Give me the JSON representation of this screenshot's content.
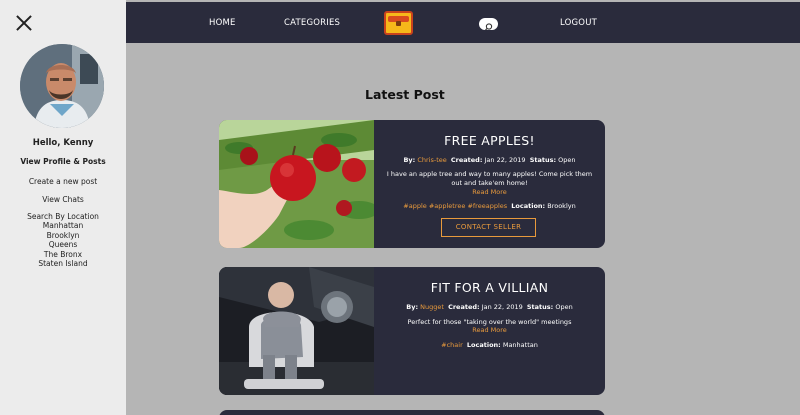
{
  "sidebar": {
    "greeting": "Hello, Kenny",
    "links": {
      "profile": "View Profile & Posts",
      "create": "Create a new post",
      "chats": "View Chats"
    },
    "search_title": "Search By Location",
    "locations": [
      "Manhattan",
      "Brooklyn",
      "Queens",
      "The Bronx",
      "Staten Island"
    ]
  },
  "nav": {
    "home": "HOME",
    "categories": "CATEGORIES",
    "logout": "LOGOUT"
  },
  "main": {
    "title": "Latest Post",
    "posts": [
      {
        "title": "FREE APPLES!",
        "by_label": "By:",
        "author": "Chris-tee",
        "created_label": "Created:",
        "created": "Jan 22, 2019",
        "status_label": "Status:",
        "status": "Open",
        "description": "I have an apple tree and way to many apples! Come pick them out and take'em home!",
        "read_more": "Read More",
        "tags": "#apple #appletree #freeapples",
        "location_label": "Location:",
        "location": "Brooklyn",
        "button": "CONTACT SELLER"
      },
      {
        "title": "FIT FOR A VILLIAN",
        "by_label": "By:",
        "author": "Nugget",
        "created_label": "Created:",
        "created": "Jan 22, 2019",
        "status_label": "Status:",
        "status": "Open",
        "description": "Perfect for those \"taking over the world\" meetings",
        "read_more": "Read More",
        "tags": "#chair",
        "location_label": "Location:",
        "location": "Manhattan"
      }
    ]
  },
  "colors": {
    "accent": "#e89a3c",
    "navbar": "#2a2b3c",
    "background": "#b5b5b5",
    "sidebar": "#ececec"
  },
  "icons": {
    "close": "close-icon",
    "logo": "treasure-chest-logo",
    "search": "search-icon"
  }
}
